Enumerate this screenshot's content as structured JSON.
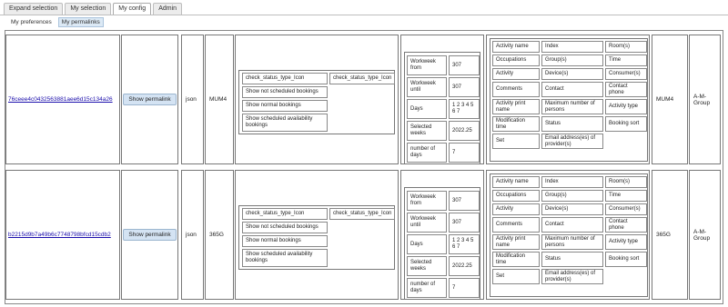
{
  "tabs": [
    "Expand selection",
    "My selection",
    "My config",
    "Admin"
  ],
  "subtabs": [
    "My preferences",
    "My permalinks"
  ],
  "rows": [
    {
      "link": "76ceee4c0432563881aee6d15c134a26",
      "button": "Show permalink",
      "format": "json",
      "code": "MUM4",
      "filters": {
        "a": "check_status_type_Icon",
        "b": "check_status_type_Icon",
        "c": "Show not scheduled bookings",
        "d": "Show normal bookings",
        "e": "Show scheduled availability bookings"
      },
      "week": {
        "wf_label": "Workweek from",
        "wf_value": "307",
        "wu_label": "Workweek until",
        "wu_value": "307",
        "days_label": "Days",
        "days_value": "1 2 3 4 5 6 7",
        "sw_label": "Selected weeks",
        "sw_value": "2022.25",
        "nd_label": "number of days",
        "nd_value": "7"
      },
      "fields": [
        [
          "Activity name",
          "Index",
          "Room(s)"
        ],
        [
          "Occupations",
          "Group(s)",
          "Time"
        ],
        [
          "Activity",
          "Device(s)",
          "Consumer(s)"
        ],
        [
          "Comments",
          "Contact",
          "Contact phone"
        ],
        [
          "Activity print name",
          "Maximum number of persons",
          "Activity type"
        ],
        [
          "Modification time",
          "Status",
          "Booking sort"
        ],
        [
          "Set",
          "Email address(es) of provider(s)",
          ""
        ]
      ],
      "code2": "MUM4",
      "group": "A-M-Group"
    },
    {
      "link": "b2215d9b7a49b6c7748798bfcd15cdb2",
      "button": "Show permalink",
      "format": "json",
      "code": "365G",
      "filters": {
        "a": "check_status_type_Icon",
        "b": "check_status_type_Icon",
        "c": "Show not scheduled bookings",
        "d": "Show normal bookings",
        "e": "Show scheduled availability bookings"
      },
      "week": {
        "wf_label": "Workweek from",
        "wf_value": "307",
        "wu_label": "Workweek until",
        "wu_value": "307",
        "days_label": "Days",
        "days_value": "1 2 3 4 5 6 7",
        "sw_label": "Selected weeks",
        "sw_value": "2022.25",
        "nd_label": "number of days",
        "nd_value": "7"
      },
      "fields": [
        [
          "Activity name",
          "Index",
          "Room(s)"
        ],
        [
          "Occupations",
          "Group(s)",
          "Time"
        ],
        [
          "Activity",
          "Device(s)",
          "Consumer(s)"
        ],
        [
          "Comments",
          "Contact",
          "Contact phone"
        ],
        [
          "Activity print name",
          "Maximum number of persons",
          "Activity type"
        ],
        [
          "Modification time",
          "Status",
          "Booking sort"
        ],
        [
          "Set",
          "Email address(es) of provider(s)",
          ""
        ]
      ],
      "code2": "365G",
      "group": "A-M-Group"
    }
  ]
}
